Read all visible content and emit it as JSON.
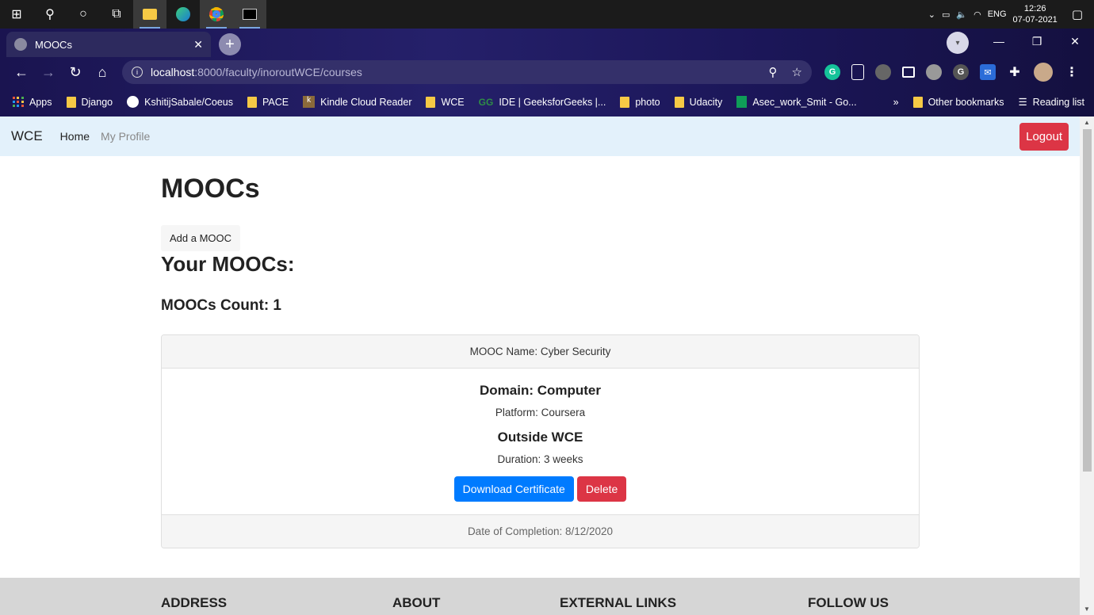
{
  "taskbar": {
    "clock_time": "12:26",
    "clock_date": "07-07-2021",
    "language": "ENG"
  },
  "browser": {
    "tab_title": "MOOCs",
    "url_host": "localhost",
    "url_path": ":8000/faculty/inoroutWCE/courses",
    "bookmarks": [
      "Apps",
      "Django",
      "KshitijSabale/Coeus",
      "PACE",
      "Kindle Cloud Reader",
      "WCE",
      "IDE | GeeksforGeeks |...",
      "photo",
      "Udacity",
      "Asec_work_Smit - Go..."
    ],
    "other_bookmarks": "Other bookmarks",
    "reading_list": "Reading list"
  },
  "site_nav": {
    "brand": "WCE",
    "home": "Home",
    "profile": "My Profile",
    "logout": "Logout"
  },
  "main": {
    "title": "MOOCs",
    "add_button": "Add a MOOC",
    "section_title": "Your MOOCs:",
    "count_text": "MOOCs Count: 1"
  },
  "mooc_card": {
    "header": "MOOC Name: Cyber Security",
    "domain": "Domain: Computer",
    "platform": "Platform: Coursera",
    "location": "Outside WCE",
    "duration": "Duration: 3 weeks",
    "download_button": "Download Certificate",
    "delete_button": "Delete",
    "footer": "Date of Completion: 8/12/2020"
  },
  "footer": {
    "address": "ADDRESS",
    "about": "ABOUT",
    "external_links": "EXTERNAL LINKS",
    "follow_us": "FOLLOW US"
  },
  "colors": {
    "navbar_bg": "#e3f1fb",
    "primary": "#007bff",
    "danger": "#dc3545"
  }
}
